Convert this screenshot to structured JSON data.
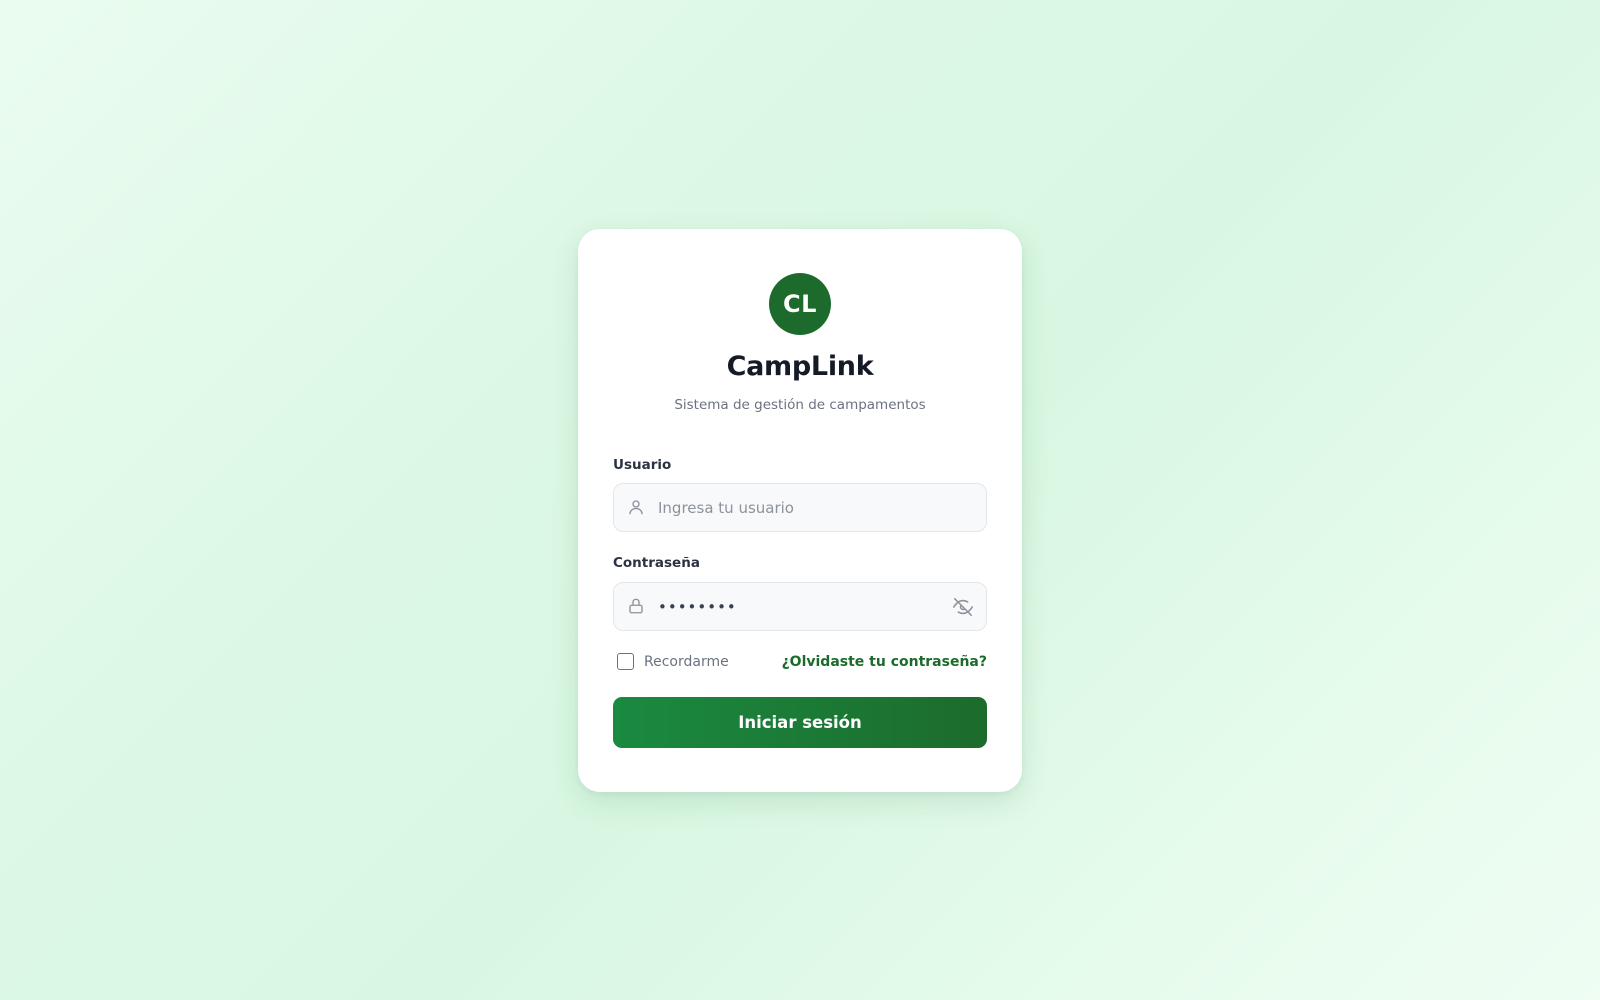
{
  "brand": {
    "logo_initials": "CL",
    "title": "CampLink",
    "subtitle": "Sistema de gestión de campamentos",
    "color": "#1c6b2c"
  },
  "form": {
    "username": {
      "label": "Usuario",
      "placeholder": "Ingresa tu usuario",
      "value": "",
      "icon": "user-icon"
    },
    "password": {
      "label": "Contraseña",
      "value": "••••••••",
      "icon": "lock-icon",
      "toggle_icon": "eye-off-icon"
    },
    "remember": {
      "label": "Recordarme",
      "checked": false
    },
    "forgot_link": "¿Olvidaste tu contraseña?",
    "submit_label": "Iniciar sesión"
  },
  "colors": {
    "accent": "#1c6b2c",
    "button_gradient_start": "#1a8a41",
    "button_gradient_end": "#1c6b2c",
    "background": "#dcf8e5"
  }
}
